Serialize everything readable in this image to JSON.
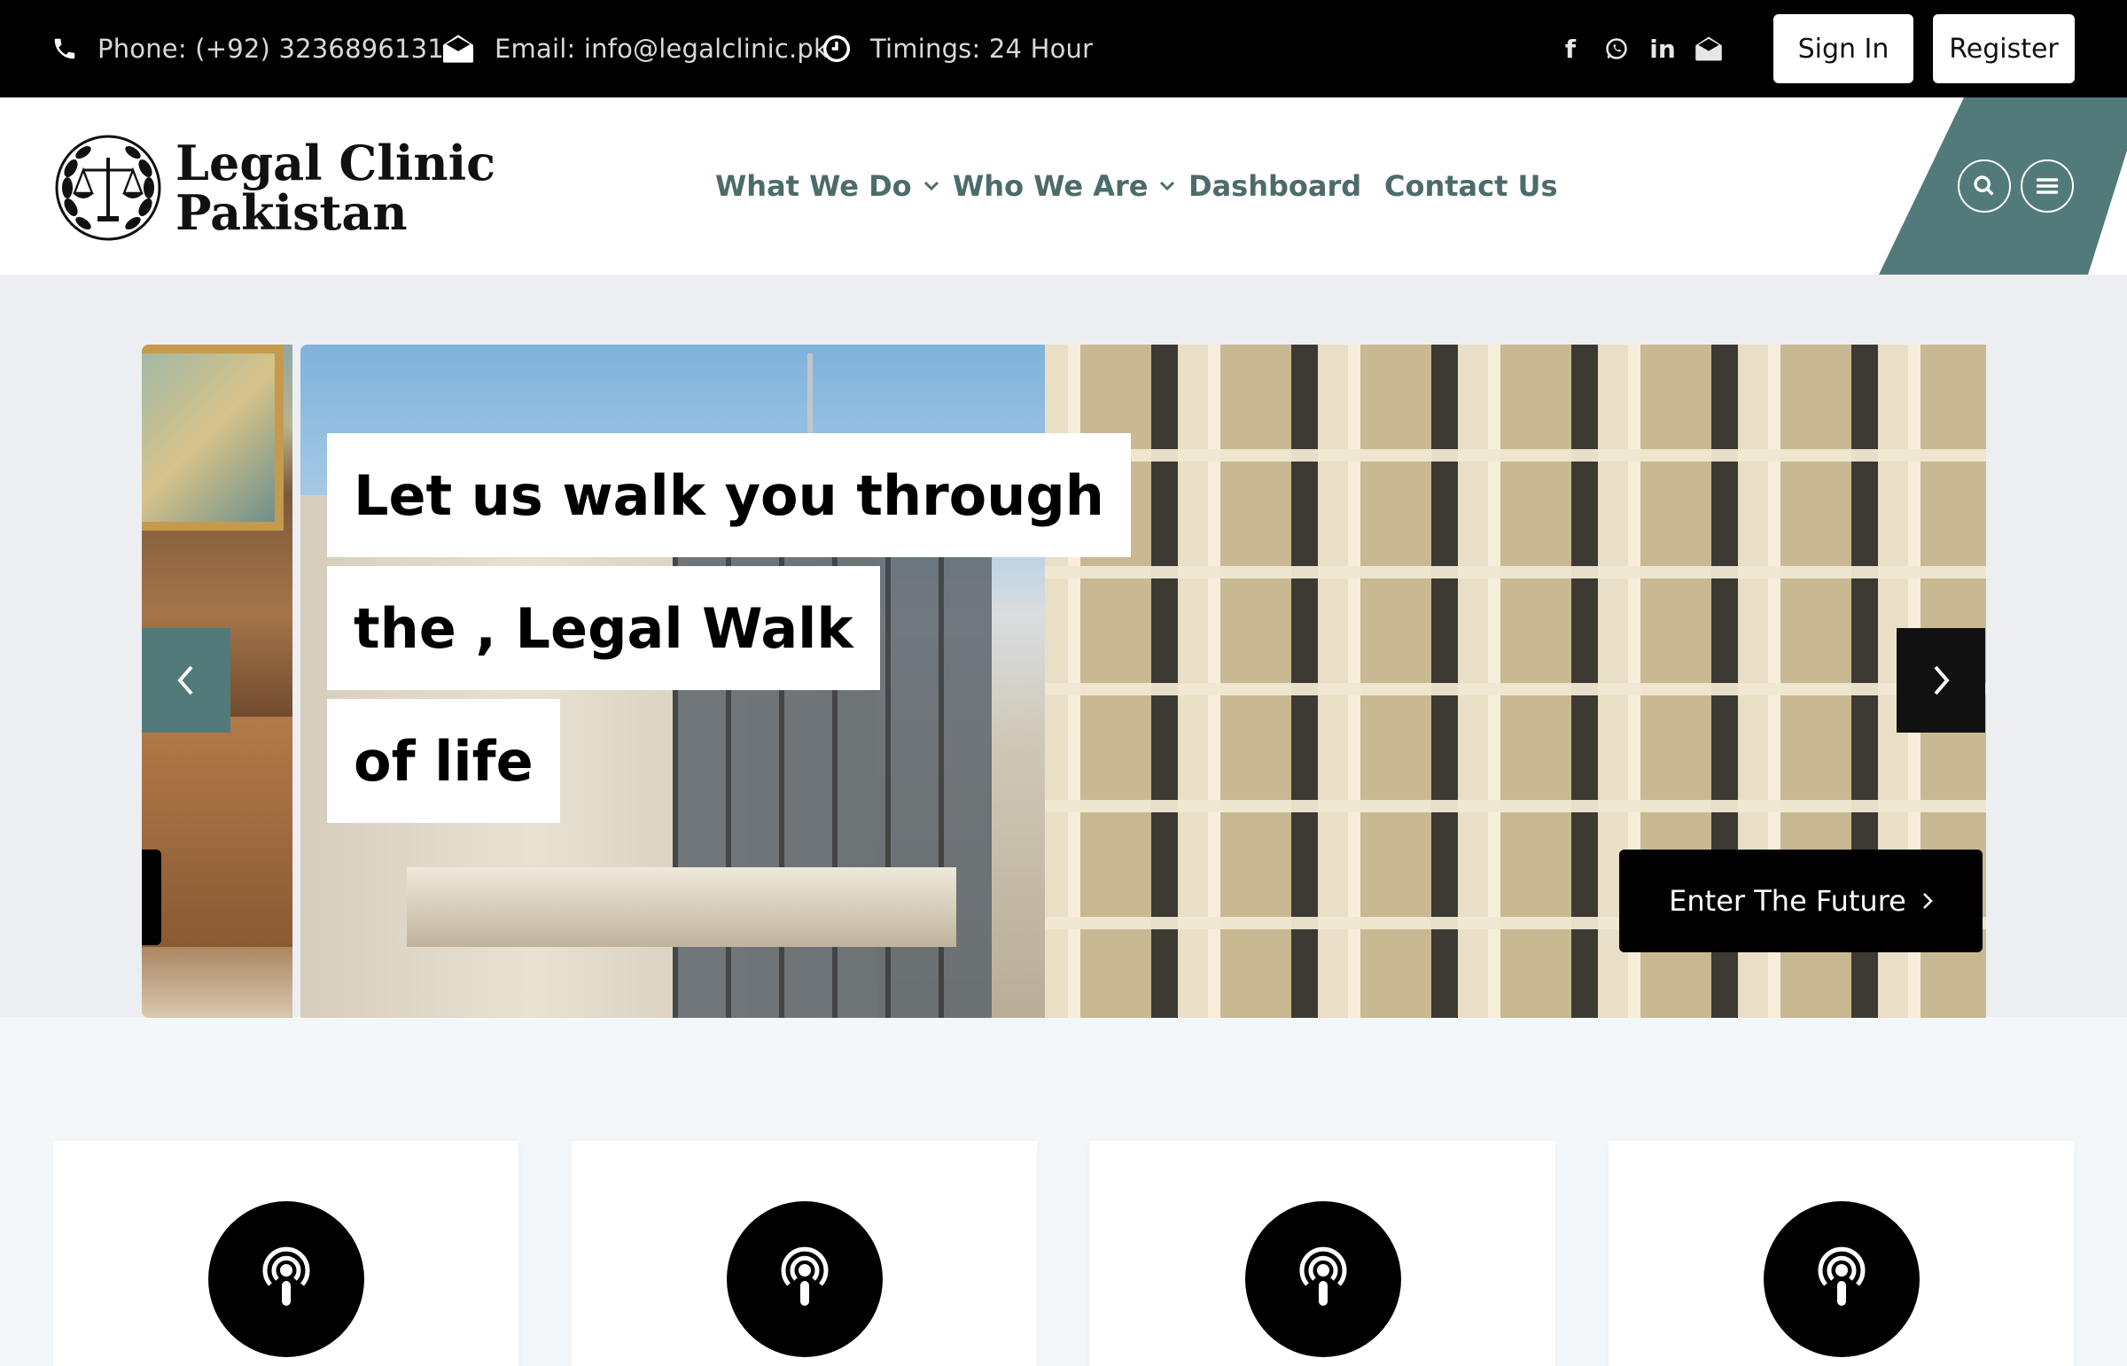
{
  "topbar": {
    "phone": "Phone: (+92) 3236896131",
    "email": "Email: info@legalclinic.pk",
    "timings": "Timings: 24 Hour",
    "sign_in": "Sign In",
    "register": "Register",
    "social_icons": [
      "facebook-icon",
      "whatsapp-icon",
      "linkedin-icon",
      "email-icon"
    ]
  },
  "header": {
    "logo_line1": "Legal Clinic",
    "logo_line2": "Pakistan",
    "nav": [
      {
        "label": "What We Do",
        "dropdown": true
      },
      {
        "label": "Who We Are",
        "dropdown": true
      },
      {
        "label": "Dashboard",
        "dropdown": false
      },
      {
        "label": "Contact Us",
        "dropdown": false
      }
    ],
    "accent_color": "#537a7a"
  },
  "hero": {
    "lines": [
      "Let us walk you through",
      "the , Legal Walk",
      "of life"
    ],
    "cta": "Enter The Future"
  },
  "cards": [
    {
      "icon": "podcast-icon"
    },
    {
      "icon": "podcast-icon"
    },
    {
      "icon": "podcast-icon"
    },
    {
      "icon": "podcast-icon"
    }
  ]
}
